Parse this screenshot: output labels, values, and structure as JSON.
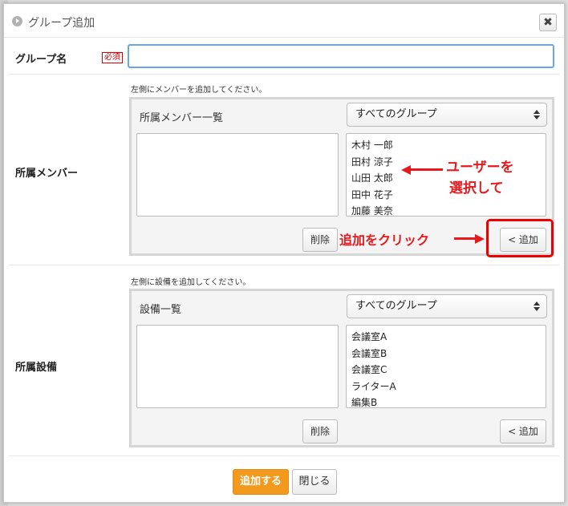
{
  "dialog": {
    "title": "グループ追加",
    "close_label": "✖"
  },
  "group_name": {
    "label": "グループ名",
    "required_badge": "必須",
    "value": ""
  },
  "members": {
    "label": "所属メンバー",
    "hint": "左側にメンバーを追加してください。",
    "panel_label": "所属メンバー一覧",
    "group_select": "すべてのグループ",
    "candidates": [
      "木村 一郎",
      "田村 涼子",
      "山田 太郎",
      "田中 花子",
      "加藤 美奈"
    ],
    "delete_label": "削除",
    "add_label": "< 追加"
  },
  "facilities": {
    "label": "所属設備",
    "hint": "左側に設備を追加してください。",
    "panel_label": "設備一覧",
    "group_select": "すべてのグループ",
    "candidates": [
      "会議室A",
      "会議室B",
      "会議室C",
      "ライターA",
      "編集B"
    ],
    "delete_label": "削除",
    "add_label": "< 追加"
  },
  "annotations": {
    "select_users_line1": "ユーザーを",
    "select_users_line2": "選択して",
    "click_add": "追加をクリック",
    "color": "#e8191c"
  },
  "footer": {
    "submit_label": "追加する",
    "close_label": "閉じる"
  },
  "colors": {
    "accent": "#f39a1e",
    "focus": "#6aa6e8",
    "required": "#dd0000"
  }
}
